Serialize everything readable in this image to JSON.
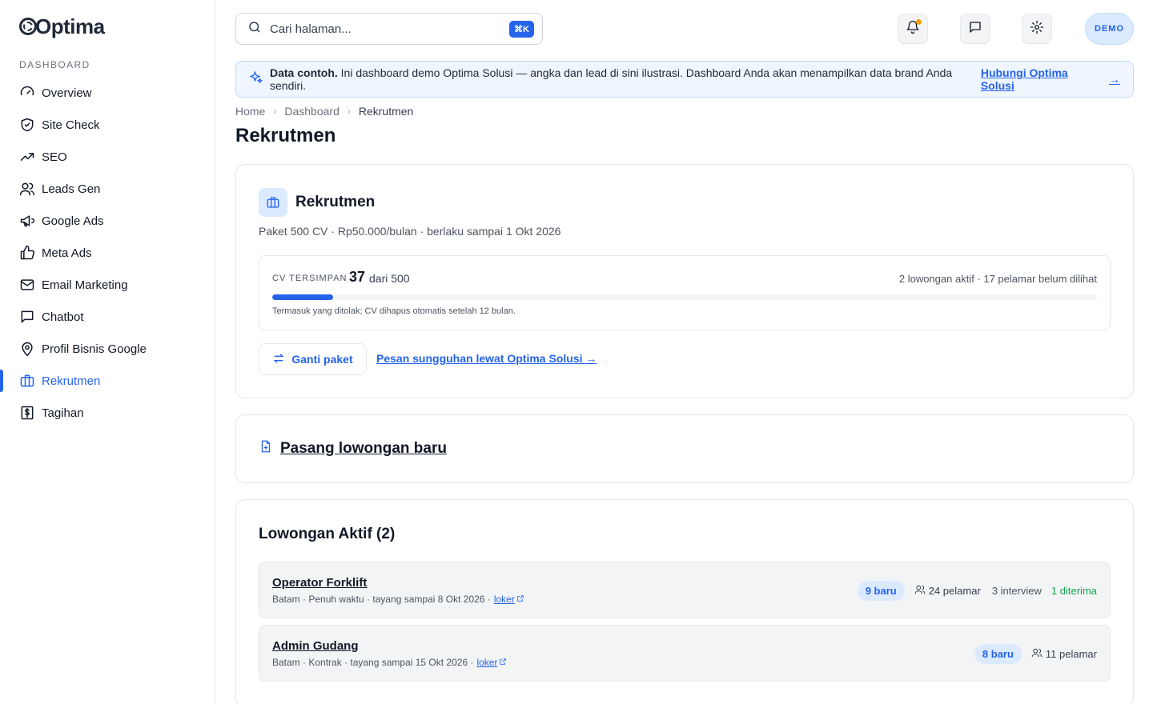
{
  "brand": {
    "name": "Optima"
  },
  "sidebar": {
    "section_title": "DASHBOARD",
    "items": [
      {
        "label": "Overview",
        "icon": "gauge-icon"
      },
      {
        "label": "Site Check",
        "icon": "shield-check-icon"
      },
      {
        "label": "SEO",
        "icon": "trending-up-icon"
      },
      {
        "label": "Leads Gen",
        "icon": "users-icon"
      },
      {
        "label": "Google Ads",
        "icon": "megaphone-icon"
      },
      {
        "label": "Meta Ads",
        "icon": "thumbs-up-icon"
      },
      {
        "label": "Email Marketing",
        "icon": "mail-icon"
      },
      {
        "label": "Chatbot",
        "icon": "chat-icon"
      },
      {
        "label": "Profil Bisnis Google",
        "icon": "map-pin-icon"
      },
      {
        "label": "Rekrutmen",
        "icon": "briefcase-icon",
        "active": true
      },
      {
        "label": "Tagihan",
        "icon": "invoice-icon"
      }
    ]
  },
  "search": {
    "placeholder": "Cari halaman...",
    "shortcut": "⌘K"
  },
  "header": {
    "avatar_label": "DEMO"
  },
  "banner": {
    "bold": "Data contoh.",
    "text": " Ini dashboard demo Optima Solusi — angka dan lead di sini ilustrasi. Dashboard Anda akan menampilkan data brand Anda sendiri.",
    "link": "Hubungi Optima Solusi"
  },
  "breadcrumb": {
    "home": "Home",
    "dashboard": "Dashboard",
    "current": "Rekrutmen"
  },
  "page_title": "Rekrutmen",
  "plan": {
    "title": "Rekrutmen",
    "subtitle": "Paket 500 CV · Rp50.000/bulan · berlaku sampai 1 Okt 2026",
    "quota_label": "CV TERSIMPAN",
    "used": "37",
    "of_text": "dari 500",
    "used_fraction": 0.074,
    "summary": "2 lowongan aktif · 17 pelamar belum dilihat",
    "note": "Termasuk yang ditolak; CV dihapus otomatis setelah 12 bulan.",
    "change_button": "Ganti paket",
    "order_link": "Pesan sungguhan lewat Optima Solusi →"
  },
  "new_job": {
    "label": "Pasang lowongan baru"
  },
  "jobs": {
    "title": "Lowongan Aktif (2)",
    "items": [
      {
        "title": "Operator Forklift",
        "meta": "Batam · Penuh waktu · tayang sampai 8 Okt 2026 ·",
        "link": "loker",
        "new": "9 baru",
        "applicants": "24 pelamar",
        "interview": "3 interview",
        "accepted": "1 diterima"
      },
      {
        "title": "Admin Gudang",
        "meta": "Batam · Kontrak · tayang sampai 15 Okt 2026 ·",
        "link": "loker",
        "new": "8 baru",
        "applicants": "11 pelamar"
      }
    ]
  },
  "colors": {
    "accent": "#2563eb",
    "banner_bg": "#eff6ff",
    "success": "#16a34a",
    "notification": "#f59e0b"
  }
}
